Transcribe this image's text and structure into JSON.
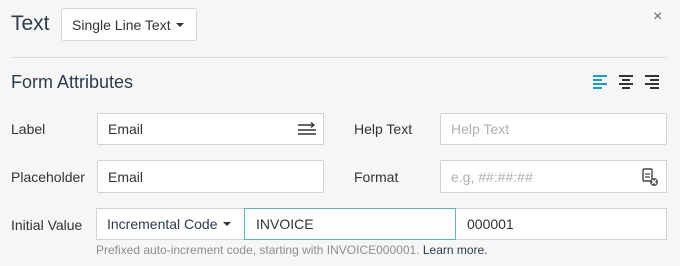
{
  "header": {
    "title": "Text",
    "field_type": "Single Line Text",
    "close_glyph": "×"
  },
  "section": {
    "title": "Form Attributes"
  },
  "alignment": {
    "options": [
      "left",
      "center",
      "right"
    ],
    "active": "left",
    "active_color": "#1a9bd7"
  },
  "form": {
    "label": {
      "label": "Label",
      "value": "Email"
    },
    "help_text": {
      "label": "Help Text",
      "placeholder": "Help Text"
    },
    "placeholder": {
      "label": "Placeholder",
      "value": "Email"
    },
    "format": {
      "label": "Format",
      "placeholder": "e.g, ##:##:##"
    },
    "initial_value": {
      "label": "Initial Value",
      "mode": "Incremental Code",
      "prefix": "INVOICE",
      "start": "000001",
      "help": "Prefixed auto-increment code, starting with INVOICE000001.",
      "learn_more": "Learn more."
    }
  },
  "colors": {
    "focus_border": "#5ab7c4",
    "heading": "#2e3b4a"
  }
}
